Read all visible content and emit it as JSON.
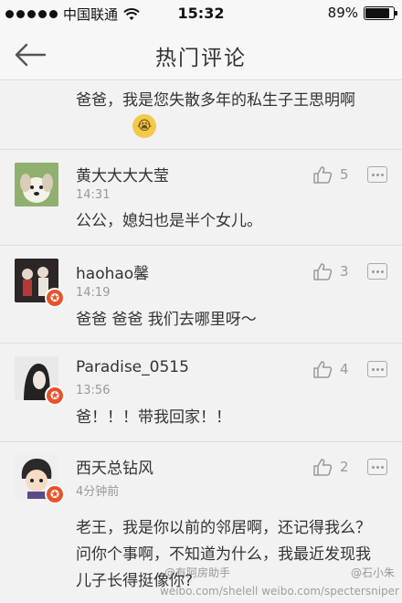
{
  "status_bar": {
    "carrier": "中国联通",
    "time": "15:32",
    "battery": "89%",
    "battery_level": 0.89
  },
  "nav": {
    "title": "热门评论"
  },
  "partial_comment": {
    "text": "爸爸，我是您失散多年的私生子王思明啊"
  },
  "comments": [
    {
      "username": "黄大大大大莹",
      "time": "14:31",
      "text": "公公，媳妇也是半个女儿。",
      "likes": "5",
      "verified": false
    },
    {
      "username": "haohao馨",
      "time": "14:19",
      "text": "爸爸 爸爸 我们去哪里呀～",
      "likes": "3",
      "verified": true
    },
    {
      "username": "Paradise_0515",
      "time": "13:56",
      "text": "爸！！！带我回家！！",
      "likes": "4",
      "verified": true
    },
    {
      "username": "西天总钻风",
      "time": "4分钟前",
      "text": "老王，我是你以前的邻居啊，还记得我么？问你个事啊，不知道为什么，我最近发现我儿子长得挺像你?",
      "likes": "2",
      "verified": true
    }
  ],
  "watermark": {
    "left": "@有阿房助手",
    "right": "@石小朱",
    "url": "weibo.com/shelell  weibo.com/spectersniper"
  }
}
